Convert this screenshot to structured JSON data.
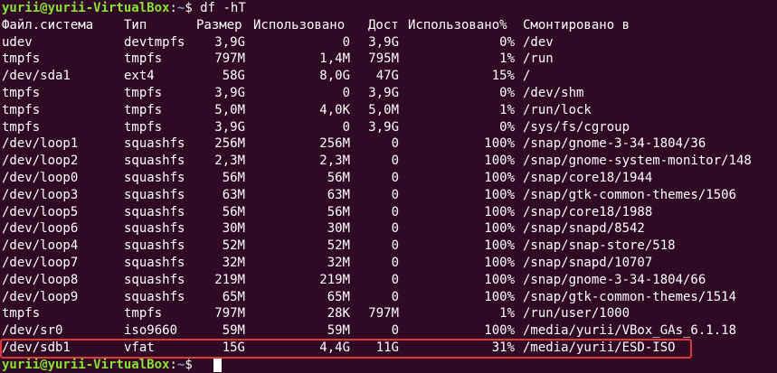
{
  "theme": {
    "background": "#300a24",
    "prompt_user_color": "#8ae234",
    "prompt_path_color": "#729fcf",
    "highlight_color": "#e0383a"
  },
  "prompt": {
    "user_host": "yurii@yurii-VirtualBox",
    "separator": ":",
    "path": "~",
    "symbol": "$ ",
    "command": "df -hT"
  },
  "headers": [
    "Файл.система",
    "Тип",
    "Размер",
    "Использовано",
    "Дост",
    "Использовано%",
    "Смонтировано в"
  ],
  "rows": [
    [
      "udev",
      "devtmpfs",
      "3,9G",
      "0",
      "3,9G",
      "0%",
      "/dev"
    ],
    [
      "tmpfs",
      "tmpfs",
      "797M",
      "1,4M",
      "795M",
      "1%",
      "/run"
    ],
    [
      "/dev/sda1",
      "ext4",
      "58G",
      "8,0G",
      "47G",
      "15%",
      "/"
    ],
    [
      "tmpfs",
      "tmpfs",
      "3,9G",
      "0",
      "3,9G",
      "0%",
      "/dev/shm"
    ],
    [
      "tmpfs",
      "tmpfs",
      "5,0M",
      "4,0K",
      "5,0M",
      "1%",
      "/run/lock"
    ],
    [
      "tmpfs",
      "tmpfs",
      "3,9G",
      "0",
      "3,9G",
      "0%",
      "/sys/fs/cgroup"
    ],
    [
      "/dev/loop1",
      "squashfs",
      "256M",
      "256M",
      "0",
      "100%",
      "/snap/gnome-3-34-1804/36"
    ],
    [
      "/dev/loop2",
      "squashfs",
      "2,3M",
      "2,3M",
      "0",
      "100%",
      "/snap/gnome-system-monitor/148"
    ],
    [
      "/dev/loop0",
      "squashfs",
      "56M",
      "56M",
      "0",
      "100%",
      "/snap/core18/1944"
    ],
    [
      "/dev/loop3",
      "squashfs",
      "63M",
      "63M",
      "0",
      "100%",
      "/snap/gtk-common-themes/1506"
    ],
    [
      "/dev/loop5",
      "squashfs",
      "56M",
      "56M",
      "0",
      "100%",
      "/snap/core18/1988"
    ],
    [
      "/dev/loop6",
      "squashfs",
      "30M",
      "30M",
      "0",
      "100%",
      "/snap/snapd/8542"
    ],
    [
      "/dev/loop4",
      "squashfs",
      "52M",
      "52M",
      "0",
      "100%",
      "/snap/snap-store/518"
    ],
    [
      "/dev/loop7",
      "squashfs",
      "32M",
      "32M",
      "0",
      "100%",
      "/snap/snapd/10707"
    ],
    [
      "/dev/loop8",
      "squashfs",
      "219M",
      "219M",
      "0",
      "100%",
      "/snap/gnome-3-34-1804/66"
    ],
    [
      "/dev/loop9",
      "squashfs",
      "65M",
      "65M",
      "0",
      "100%",
      "/snap/gtk-common-themes/1514"
    ],
    [
      "tmpfs",
      "tmpfs",
      "797M",
      "28K",
      "797M",
      "1%",
      "/run/user/1000"
    ],
    [
      "/dev/sr0",
      "iso9660",
      "59M",
      "59M",
      "0",
      "100%",
      "/media/yurii/VBox_GAs_6.1.18"
    ],
    [
      "/dev/sdb1",
      "vfat",
      "15G",
      "4,4G",
      "11G",
      "31%",
      "/media/yurii/ESD-ISO"
    ]
  ],
  "highlighted_row_index": 18
}
